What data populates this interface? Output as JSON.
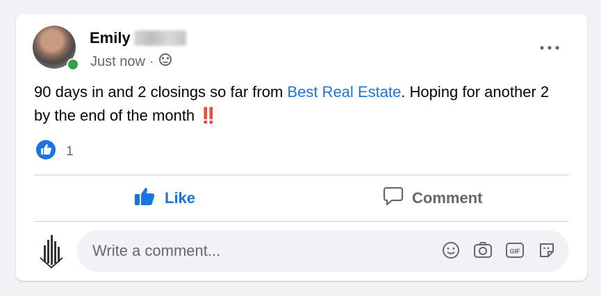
{
  "post": {
    "author_first": "Emily",
    "time": "Just now",
    "separator": "·",
    "text_before": "90 days in and 2 closings so far from ",
    "link_text": "Best Real Estate",
    "text_after": ". Hoping for another 2 by the end of the month ",
    "emoji": "‼️",
    "reaction_count": "1"
  },
  "actions": {
    "like_label": "Like",
    "comment_label": "Comment"
  },
  "comment_box": {
    "placeholder": "Write a comment..."
  },
  "colors": {
    "accent": "#1b74e4",
    "online": "#31a24c",
    "muted": "#65676b"
  },
  "icons": [
    "globe-icon",
    "more-icon",
    "like-reaction-icon",
    "thumbs-up-icon",
    "comment-icon",
    "smiley-icon",
    "camera-icon",
    "gif-icon",
    "sticker-icon"
  ]
}
